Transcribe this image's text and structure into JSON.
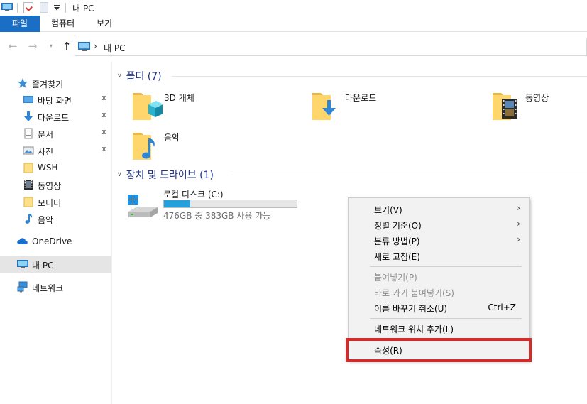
{
  "title": "내 PC",
  "ribbon": {
    "tabs": [
      "파일",
      "컴퓨터",
      "보기"
    ]
  },
  "address": {
    "chevron": "›",
    "location": "내 PC"
  },
  "nav_icons": {
    "back": "←",
    "forward": "→",
    "history": "▾",
    "up": "↑"
  },
  "sidebar": {
    "quick_access": "즐겨찾기",
    "items": [
      {
        "label": "바탕 화면",
        "icon": "desktop-icon",
        "pinned": true
      },
      {
        "label": "다운로드",
        "icon": "download-icon",
        "pinned": true
      },
      {
        "label": "문서",
        "icon": "document-icon",
        "pinned": true
      },
      {
        "label": "사진",
        "icon": "picture-icon",
        "pinned": true
      },
      {
        "label": "WSH",
        "icon": "folder-icon",
        "pinned": false
      },
      {
        "label": "동영상",
        "icon": "video-icon",
        "pinned": false
      },
      {
        "label": "모니터",
        "icon": "folder-icon",
        "pinned": false
      },
      {
        "label": "음악",
        "icon": "music-icon",
        "pinned": false
      }
    ],
    "onedrive": "OneDrive",
    "this_pc": "내 PC",
    "network": "네트워크"
  },
  "folders_group": {
    "title": "폴더 (7)",
    "folders": [
      "3D 개체",
      "다운로드",
      "동영상",
      "음악"
    ]
  },
  "drives_group": {
    "title": "장치 및 드라이브 (1)",
    "drive": {
      "name": "로컬 디스크 (C:)",
      "status": "476GB 중 383GB 사용 가능",
      "used_fraction": 0.2
    }
  },
  "context_menu": {
    "view": "보기(V)",
    "sort": "정렬 기준(O)",
    "group": "분류 방법(P)",
    "refresh": "새로 고침(E)",
    "paste": "붙여넣기(P)",
    "paste_shortcut": "바로 가기 붙여넣기(S)",
    "undo_rename": "이름 바꾸기 취소(U)",
    "undo_shortcut": "Ctrl+Z",
    "add_network_location": "네트워크 위치 추가(L)",
    "properties": "속성(R)",
    "submenu_arrow": "›"
  },
  "colors": {
    "accent": "#1a6ec4",
    "highlight_box": "#d42a2a",
    "drive_bar": "#26a0da",
    "group_title": "#1e3287"
  }
}
